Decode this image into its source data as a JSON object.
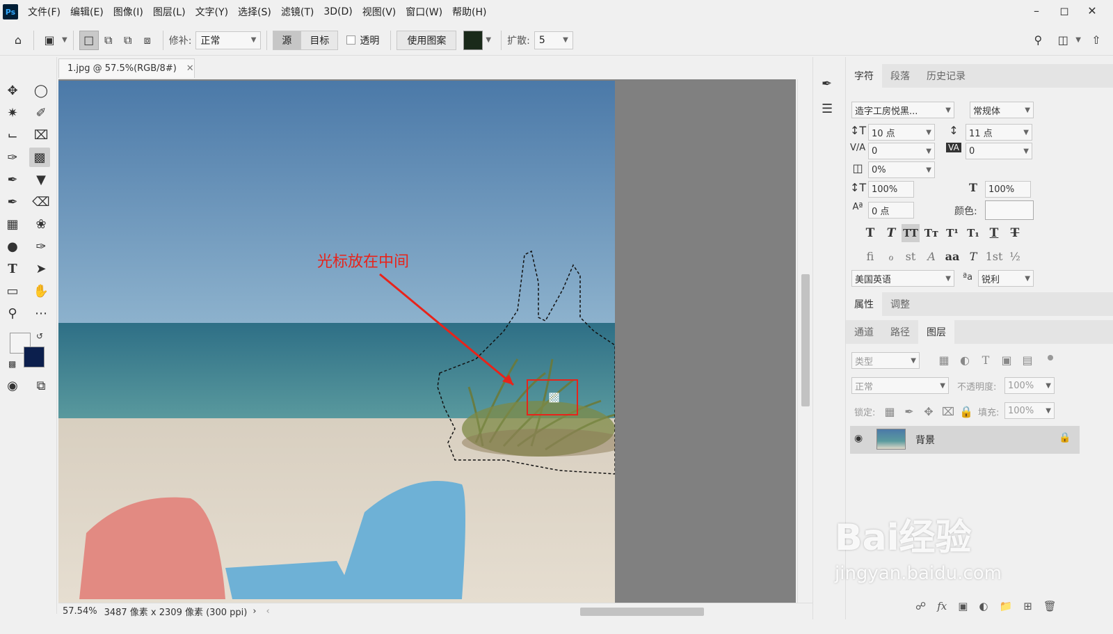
{
  "app": {
    "logo": "Ps"
  },
  "menu": [
    "文件(F)",
    "编辑(E)",
    "图像(I)",
    "图层(L)",
    "文字(Y)",
    "选择(S)",
    "滤镜(T)",
    "3D(D)",
    "视图(V)",
    "窗口(W)",
    "帮助(H)"
  ],
  "options": {
    "patch_label": "修补:",
    "patch_mode": "正常",
    "source": "源",
    "target": "目标",
    "transparent": "透明",
    "use_pattern": "使用图案",
    "diffusion_label": "扩散:",
    "diffusion_value": "5"
  },
  "document": {
    "tab_title": "1.jpg @ 57.5%(RGB/8#)"
  },
  "annotation": {
    "text": "光标放在中间"
  },
  "status": {
    "zoom": "57.54%",
    "info": "3487 像素 x 2309 像素 (300 ppi)"
  },
  "character_panel": {
    "tabs": [
      "字符",
      "段落",
      "历史记录"
    ],
    "font_family": "造字工房悦黑...",
    "font_style": "常规体",
    "size": "10 点",
    "leading": "11 点",
    "kerning": "0",
    "tracking": "0",
    "tsume": "0%",
    "vertical_scale": "100%",
    "horizontal_scale": "100%",
    "baseline": "0 点",
    "color_label": "颜色:",
    "language": "美国英语",
    "antialias_label": "ªa",
    "antialias": "锐利"
  },
  "props_panel": {
    "tabs": [
      "属性",
      "调整"
    ]
  },
  "layers_panel": {
    "tabs": [
      "通道",
      "路径",
      "图层"
    ],
    "filter_placeholder": "类型",
    "blend": "正常",
    "opacity_label": "不透明度:",
    "opacity": "100%",
    "lock_label": "锁定:",
    "fill_label": "填充:",
    "fill": "100%",
    "layer_name": "背景"
  },
  "watermark": {
    "brand": "Bai经验",
    "url": "jingyan.baidu.com"
  },
  "colors": {
    "accent_red": "#e8231a",
    "bg_color_swatch": "#0c1f4d"
  }
}
